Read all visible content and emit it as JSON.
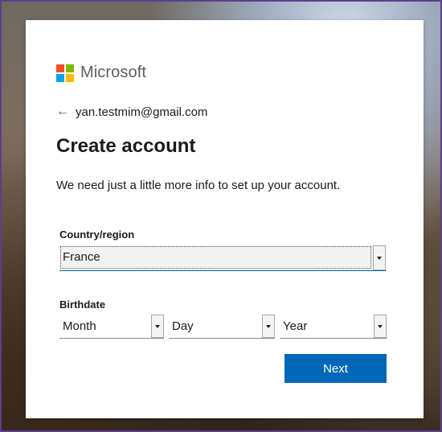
{
  "brand": {
    "name": "Microsoft",
    "logo_colors": [
      "#f25022",
      "#7fba00",
      "#00a4ef",
      "#ffb900"
    ]
  },
  "identity": {
    "back_icon": "arrow-left-icon",
    "back_glyph": "←",
    "email": "yan.testmim@gmail.com"
  },
  "page": {
    "title": "Create account",
    "description": "We need just a little more info to set up your account."
  },
  "form": {
    "country_label": "Country/region",
    "country_value": "France",
    "birthdate_label": "Birthdate",
    "month_value": "Month",
    "day_value": "Day",
    "year_value": "Year",
    "dropdown_icon": "chevron-down-icon"
  },
  "actions": {
    "next_label": "Next",
    "primary_color": "#0067b8"
  }
}
